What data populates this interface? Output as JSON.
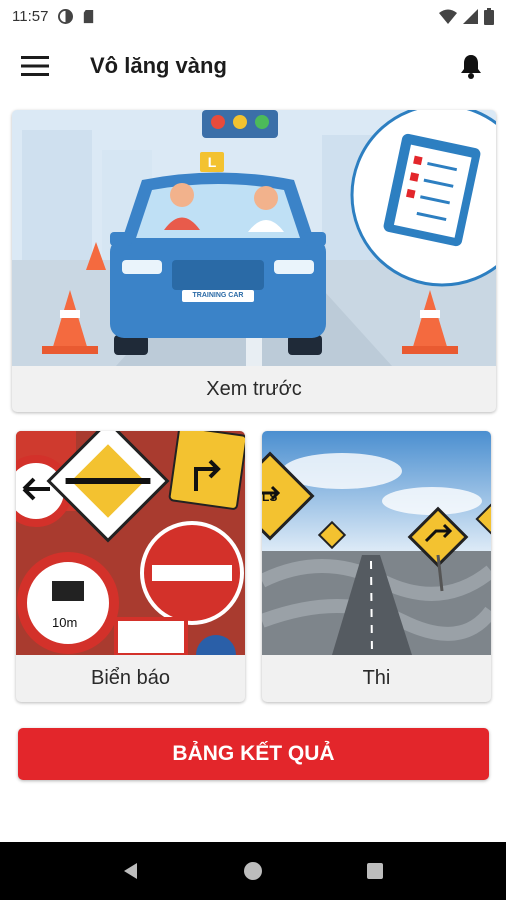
{
  "status_bar": {
    "time": "11:57",
    "icons": [
      "data-saver-icon",
      "sd-card-icon",
      "wifi-icon",
      "signal-icon",
      "battery-icon"
    ]
  },
  "app_bar": {
    "title": "Vô lăng vàng",
    "menu_icon": "hamburger-menu-icon",
    "notification_icon": "bell-icon"
  },
  "cards": {
    "preview": {
      "label": "Xem trước",
      "image": "training-car-illustration"
    },
    "signs": {
      "label": "Biển báo",
      "image": "traffic-signs-photo"
    },
    "exam": {
      "label": "Thi",
      "image": "winding-roads-photo"
    }
  },
  "car_plate": "TRAINING CAR",
  "car_badge": "L",
  "result_button": {
    "label": "BẢNG KẾT QUẢ"
  },
  "nav_bar": {
    "icons": [
      "back-icon",
      "home-icon",
      "recents-icon"
    ]
  },
  "colors": {
    "accent": "#e3262b",
    "car_blue": "#3b83c8",
    "sky": "#dbe9f5"
  }
}
